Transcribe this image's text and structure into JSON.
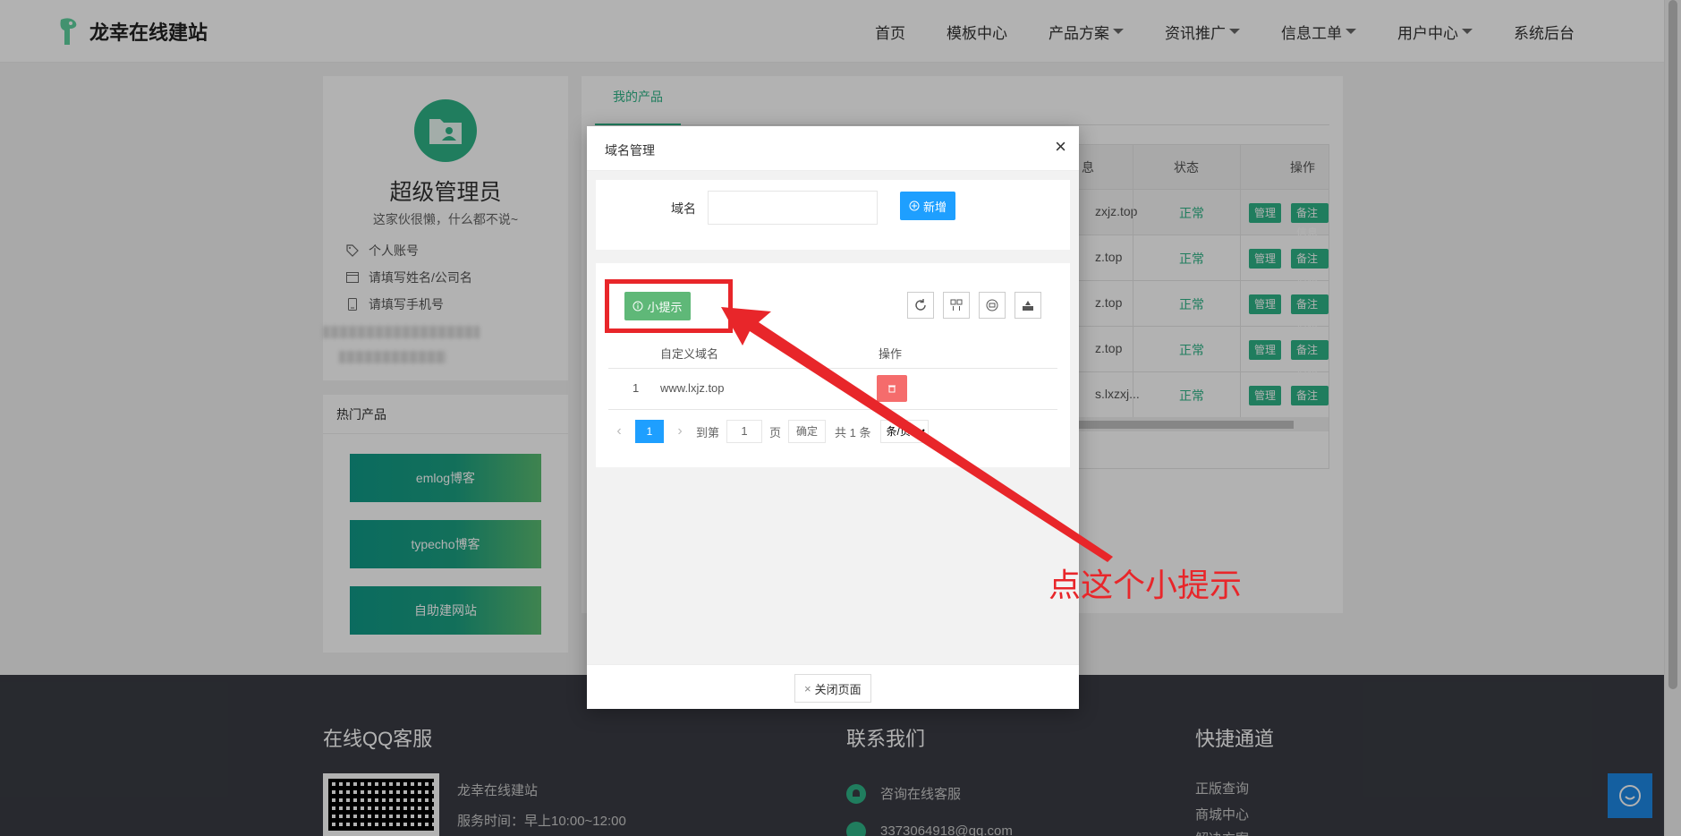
{
  "brand": {
    "name": "龙幸在线建站"
  },
  "nav": [
    {
      "label": "首页",
      "dropdown": false
    },
    {
      "label": "模板中心",
      "dropdown": false
    },
    {
      "label": "产品方案",
      "dropdown": true
    },
    {
      "label": "资讯推广",
      "dropdown": true
    },
    {
      "label": "信息工单",
      "dropdown": true
    },
    {
      "label": "用户中心",
      "dropdown": true
    },
    {
      "label": "系统后台",
      "dropdown": false
    }
  ],
  "profile": {
    "name": "超级管理员",
    "bio": "这家伙很懒，什么都不说~",
    "account": "个人账号",
    "company": "请填写姓名/公司名",
    "phone": "请填写手机号"
  },
  "hot": {
    "title": "热门产品",
    "items": [
      "emlog博客",
      "typecho博客",
      "自助建网站"
    ]
  },
  "main": {
    "tab": "我的产品",
    "columns": {
      "info": "息",
      "status": "状态",
      "ops": "操作"
    },
    "rows": [
      {
        "domain": "zxjz.top",
        "status": "正常"
      },
      {
        "domain": "z.top",
        "status": "正常"
      },
      {
        "domain": "z.top",
        "status": "正常"
      },
      {
        "domain": "z.top",
        "status": "正常"
      },
      {
        "domain": "s.lxzxj...",
        "status": "正常"
      }
    ],
    "manage_label": "管理",
    "remark_label": "备注信息"
  },
  "modal": {
    "title": "域名管理",
    "domain_label": "域名",
    "domain_value": "",
    "add_label": "新增",
    "tip_label": "小提示",
    "table": {
      "col_domain": "自定义域名",
      "col_ops": "操作",
      "rows": [
        {
          "index": "1",
          "domain": "www.lxjz.top"
        }
      ]
    },
    "pager": {
      "current": "1",
      "goto": "到第",
      "page_input": "1",
      "page_unit": "页",
      "confirm": "确定",
      "total": "共 1 条",
      "per_page": "条/页"
    },
    "close_page": "关闭页面"
  },
  "annotation": {
    "text": "点这个小提示"
  },
  "footer": {
    "qq_title": "在线QQ客服",
    "site_name": "龙幸在线建站",
    "service_hours": "服务时间：早上10:00~12:00",
    "contact_title": "联系我们",
    "consult": "咨询在线客服",
    "email": "3373064918@qq.com",
    "quick_title": "快捷通道",
    "quick_links": [
      "正版查询",
      "商城中心",
      "解决方案"
    ]
  },
  "colors": {
    "accent": "#2eb487",
    "blue": "#1e9fff",
    "red": "#e8262a",
    "footer_bg": "#3a3c44"
  }
}
